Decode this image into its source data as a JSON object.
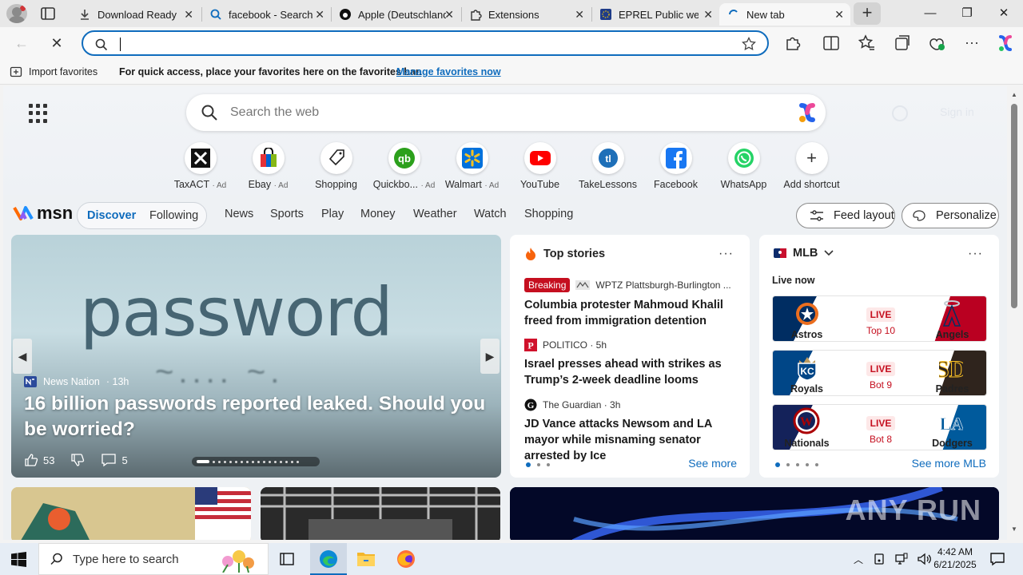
{
  "browser": {
    "tabs": [
      {
        "title": "Download Ready",
        "icon": "download-icon"
      },
      {
        "title": "facebook - Search",
        "icon": "search-icon"
      },
      {
        "title": "Apple (Deutschland)",
        "icon": "apple-icon"
      },
      {
        "title": "Extensions",
        "icon": "extensions-icon"
      },
      {
        "title": "EPREL Public website",
        "icon": "eprel-icon"
      },
      {
        "title": "New tab",
        "icon": "loading-icon"
      }
    ],
    "address_value": "",
    "favbar": {
      "import_label": "Import favorites",
      "message": "For quick access, place your favorites here on the favorites bar.",
      "link": "Manage favorites now"
    }
  },
  "newtab": {
    "search_placeholder": "Search the web",
    "signin_label": "Sign in",
    "shortcuts": [
      {
        "label": "TaxACT",
        "ad": "· Ad"
      },
      {
        "label": "Ebay",
        "ad": "· Ad"
      },
      {
        "label": "Shopping",
        "ad": ""
      },
      {
        "label": "Quickbo...",
        "ad": "· Ad"
      },
      {
        "label": "Walmart",
        "ad": "· Ad"
      },
      {
        "label": "YouTube",
        "ad": ""
      },
      {
        "label": "TakeLessons",
        "ad": ""
      },
      {
        "label": "Facebook",
        "ad": ""
      },
      {
        "label": "WhatsApp",
        "ad": ""
      },
      {
        "label": "Add shortcut",
        "ad": ""
      }
    ]
  },
  "msn": {
    "logo": "msn",
    "discover": "Discover",
    "following": "Following",
    "nav": [
      "News",
      "Sports",
      "Play",
      "Money",
      "Weather",
      "Watch",
      "Shopping"
    ],
    "feed_layout": "Feed layout",
    "personalize": "Personalize"
  },
  "hero_story": {
    "source": "News Nation",
    "time": "· 13h",
    "title": "16 billion passwords reported leaked. Should you be worried?",
    "likes": "53",
    "comments": "5",
    "image_text": "password"
  },
  "top_stories": {
    "header": "Top stories",
    "items": [
      {
        "badge": "Breaking",
        "source": "WPTZ Plattsburgh-Burlington ...",
        "headline": "Columbia protester Mahmoud Khalil freed from immigration detention"
      },
      {
        "badge": "",
        "source": "POLITICO · 5h",
        "headline": "Israel presses ahead with strikes as Trump’s 2-week deadline looms"
      },
      {
        "badge": "",
        "source": "The Guardian · 3h",
        "headline": "JD Vance attacks Newsom and LA mayor while misnaming senator arrested by Ice"
      }
    ],
    "see_more": "See more"
  },
  "mlb": {
    "header": "MLB",
    "live_now": "Live now",
    "games": [
      {
        "home": "Astros",
        "away": "Angels",
        "status": "LIVE",
        "inning": "Top 10"
      },
      {
        "home": "Royals",
        "away": "Padres",
        "status": "LIVE",
        "inning": "Bot 9"
      },
      {
        "home": "Nationals",
        "away": "Dodgers",
        "status": "LIVE",
        "inning": "Bot 8"
      }
    ],
    "see_more": "See more MLB"
  },
  "watermark": "ANY RUN",
  "taskbar": {
    "search_placeholder": "Type here to search",
    "time": "4:42 AM",
    "date": "6/21/2025"
  },
  "colors": {
    "accent": "#0f6cbd",
    "live_red": "#c50f1f"
  }
}
